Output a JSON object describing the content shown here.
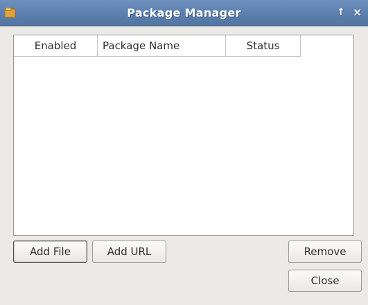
{
  "window": {
    "title": "Package Manager",
    "icon": "package-icon",
    "controls": {
      "shade": "↑",
      "close": "×"
    }
  },
  "packages_table": {
    "columns": [
      "Enabled",
      "Package Name",
      "Status"
    ],
    "rows": []
  },
  "buttons": {
    "add_file": "Add File",
    "add_url": "Add URL",
    "remove": "Remove",
    "close": "Close"
  },
  "colors": {
    "titlebar": "#5b7fae",
    "window_bg": "#eceae6"
  }
}
